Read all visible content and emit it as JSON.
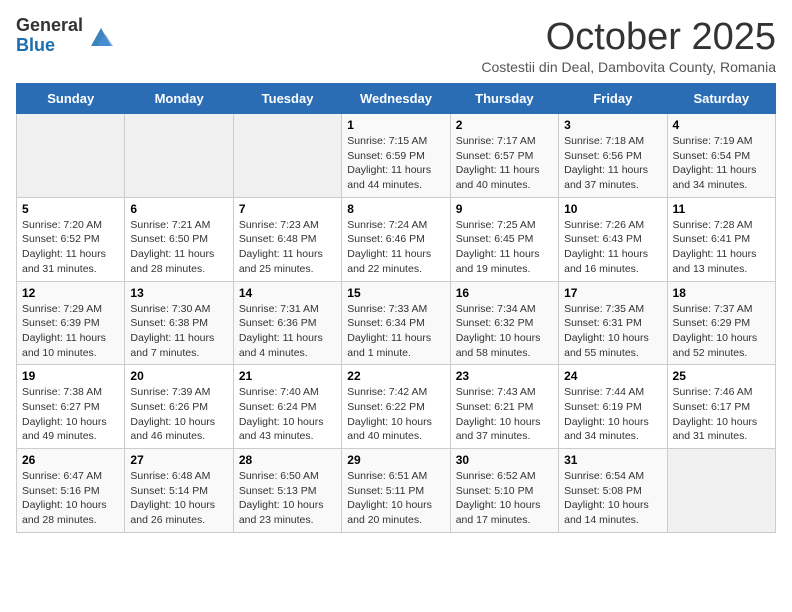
{
  "header": {
    "logo_general": "General",
    "logo_blue": "Blue",
    "month_title": "October 2025",
    "subtitle": "Costestii din Deal, Dambovita County, Romania"
  },
  "weekdays": [
    "Sunday",
    "Monday",
    "Tuesday",
    "Wednesday",
    "Thursday",
    "Friday",
    "Saturday"
  ],
  "weeks": [
    [
      {
        "day": "",
        "info": ""
      },
      {
        "day": "",
        "info": ""
      },
      {
        "day": "",
        "info": ""
      },
      {
        "day": "1",
        "info": "Sunrise: 7:15 AM\nSunset: 6:59 PM\nDaylight: 11 hours and 44 minutes."
      },
      {
        "day": "2",
        "info": "Sunrise: 7:17 AM\nSunset: 6:57 PM\nDaylight: 11 hours and 40 minutes."
      },
      {
        "day": "3",
        "info": "Sunrise: 7:18 AM\nSunset: 6:56 PM\nDaylight: 11 hours and 37 minutes."
      },
      {
        "day": "4",
        "info": "Sunrise: 7:19 AM\nSunset: 6:54 PM\nDaylight: 11 hours and 34 minutes."
      }
    ],
    [
      {
        "day": "5",
        "info": "Sunrise: 7:20 AM\nSunset: 6:52 PM\nDaylight: 11 hours and 31 minutes."
      },
      {
        "day": "6",
        "info": "Sunrise: 7:21 AM\nSunset: 6:50 PM\nDaylight: 11 hours and 28 minutes."
      },
      {
        "day": "7",
        "info": "Sunrise: 7:23 AM\nSunset: 6:48 PM\nDaylight: 11 hours and 25 minutes."
      },
      {
        "day": "8",
        "info": "Sunrise: 7:24 AM\nSunset: 6:46 PM\nDaylight: 11 hours and 22 minutes."
      },
      {
        "day": "9",
        "info": "Sunrise: 7:25 AM\nSunset: 6:45 PM\nDaylight: 11 hours and 19 minutes."
      },
      {
        "day": "10",
        "info": "Sunrise: 7:26 AM\nSunset: 6:43 PM\nDaylight: 11 hours and 16 minutes."
      },
      {
        "day": "11",
        "info": "Sunrise: 7:28 AM\nSunset: 6:41 PM\nDaylight: 11 hours and 13 minutes."
      }
    ],
    [
      {
        "day": "12",
        "info": "Sunrise: 7:29 AM\nSunset: 6:39 PM\nDaylight: 11 hours and 10 minutes."
      },
      {
        "day": "13",
        "info": "Sunrise: 7:30 AM\nSunset: 6:38 PM\nDaylight: 11 hours and 7 minutes."
      },
      {
        "day": "14",
        "info": "Sunrise: 7:31 AM\nSunset: 6:36 PM\nDaylight: 11 hours and 4 minutes."
      },
      {
        "day": "15",
        "info": "Sunrise: 7:33 AM\nSunset: 6:34 PM\nDaylight: 11 hours and 1 minute."
      },
      {
        "day": "16",
        "info": "Sunrise: 7:34 AM\nSunset: 6:32 PM\nDaylight: 10 hours and 58 minutes."
      },
      {
        "day": "17",
        "info": "Sunrise: 7:35 AM\nSunset: 6:31 PM\nDaylight: 10 hours and 55 minutes."
      },
      {
        "day": "18",
        "info": "Sunrise: 7:37 AM\nSunset: 6:29 PM\nDaylight: 10 hours and 52 minutes."
      }
    ],
    [
      {
        "day": "19",
        "info": "Sunrise: 7:38 AM\nSunset: 6:27 PM\nDaylight: 10 hours and 49 minutes."
      },
      {
        "day": "20",
        "info": "Sunrise: 7:39 AM\nSunset: 6:26 PM\nDaylight: 10 hours and 46 minutes."
      },
      {
        "day": "21",
        "info": "Sunrise: 7:40 AM\nSunset: 6:24 PM\nDaylight: 10 hours and 43 minutes."
      },
      {
        "day": "22",
        "info": "Sunrise: 7:42 AM\nSunset: 6:22 PM\nDaylight: 10 hours and 40 minutes."
      },
      {
        "day": "23",
        "info": "Sunrise: 7:43 AM\nSunset: 6:21 PM\nDaylight: 10 hours and 37 minutes."
      },
      {
        "day": "24",
        "info": "Sunrise: 7:44 AM\nSunset: 6:19 PM\nDaylight: 10 hours and 34 minutes."
      },
      {
        "day": "25",
        "info": "Sunrise: 7:46 AM\nSunset: 6:17 PM\nDaylight: 10 hours and 31 minutes."
      }
    ],
    [
      {
        "day": "26",
        "info": "Sunrise: 6:47 AM\nSunset: 5:16 PM\nDaylight: 10 hours and 28 minutes."
      },
      {
        "day": "27",
        "info": "Sunrise: 6:48 AM\nSunset: 5:14 PM\nDaylight: 10 hours and 26 minutes."
      },
      {
        "day": "28",
        "info": "Sunrise: 6:50 AM\nSunset: 5:13 PM\nDaylight: 10 hours and 23 minutes."
      },
      {
        "day": "29",
        "info": "Sunrise: 6:51 AM\nSunset: 5:11 PM\nDaylight: 10 hours and 20 minutes."
      },
      {
        "day": "30",
        "info": "Sunrise: 6:52 AM\nSunset: 5:10 PM\nDaylight: 10 hours and 17 minutes."
      },
      {
        "day": "31",
        "info": "Sunrise: 6:54 AM\nSunset: 5:08 PM\nDaylight: 10 hours and 14 minutes."
      },
      {
        "day": "",
        "info": ""
      }
    ]
  ]
}
